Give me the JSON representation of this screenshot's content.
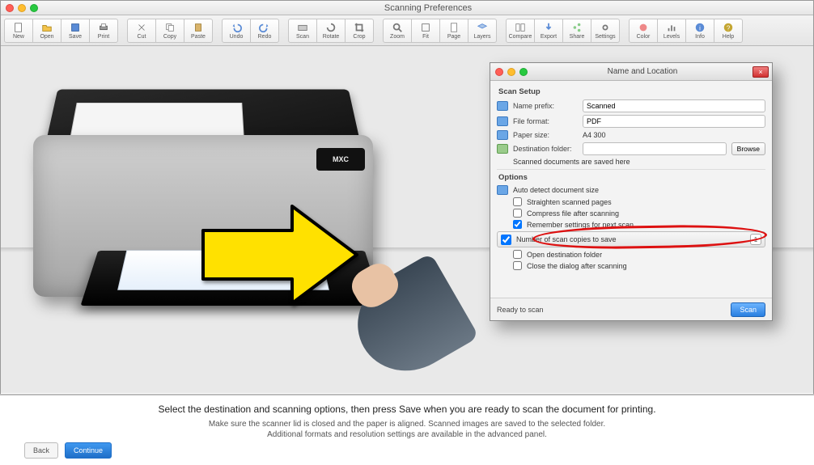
{
  "window": {
    "title": "Scanning Preferences"
  },
  "toolbar": {
    "buttons": [
      {
        "label": "New"
      },
      {
        "label": "Open"
      },
      {
        "label": "Save"
      },
      {
        "label": "Print"
      },
      {
        "label": "Cut"
      },
      {
        "label": "Copy"
      },
      {
        "label": "Paste"
      },
      {
        "label": "Undo"
      },
      {
        "label": "Redo"
      },
      {
        "label": "Scan"
      },
      {
        "label": "Rotate"
      },
      {
        "label": "Crop"
      },
      {
        "label": "Zoom"
      },
      {
        "label": "Fit"
      },
      {
        "label": "Page"
      },
      {
        "label": "Layers"
      },
      {
        "label": "Compare"
      },
      {
        "label": "Export"
      },
      {
        "label": "Share"
      },
      {
        "label": "Settings"
      },
      {
        "label": "Color"
      },
      {
        "label": "Levels"
      },
      {
        "label": "Info"
      },
      {
        "label": "Help"
      }
    ]
  },
  "scanner": {
    "brand": "MXC"
  },
  "dialog": {
    "title": "Name and Location",
    "close": "×",
    "section_top": "Scan Setup",
    "rows": {
      "prefix_label": "Name prefix:",
      "prefix_value": "Scanned",
      "format_label": "File format:",
      "format_value": "PDF",
      "size_label": "Paper size:",
      "size_value": "A4 300",
      "location_label": "Destination folder:",
      "location_value": "",
      "browse": "Browse",
      "summary": "Scanned documents are saved here"
    },
    "section_mid": "Options",
    "opts": {
      "o1": "Auto detect document size",
      "o2": "Straighten scanned pages",
      "o3": "Compress file after scanning",
      "o4": "Remember settings for next scan",
      "o5_label": "Number of scan copies to save",
      "o5_value": "1",
      "o6": "Open destination folder",
      "o7": "Close the dialog after scanning"
    },
    "footer_label": "Ready to scan",
    "ok": "Scan"
  },
  "caption": {
    "heading": "Select the destination and scanning options, then press Save when you are ready to scan the document for printing.",
    "line1": "Make sure the scanner lid is closed and the paper is aligned. Scanned images are saved to the selected folder.",
    "line2": "Additional formats and resolution settings are available in the advanced panel.",
    "prev": "Back",
    "next": "Continue"
  }
}
